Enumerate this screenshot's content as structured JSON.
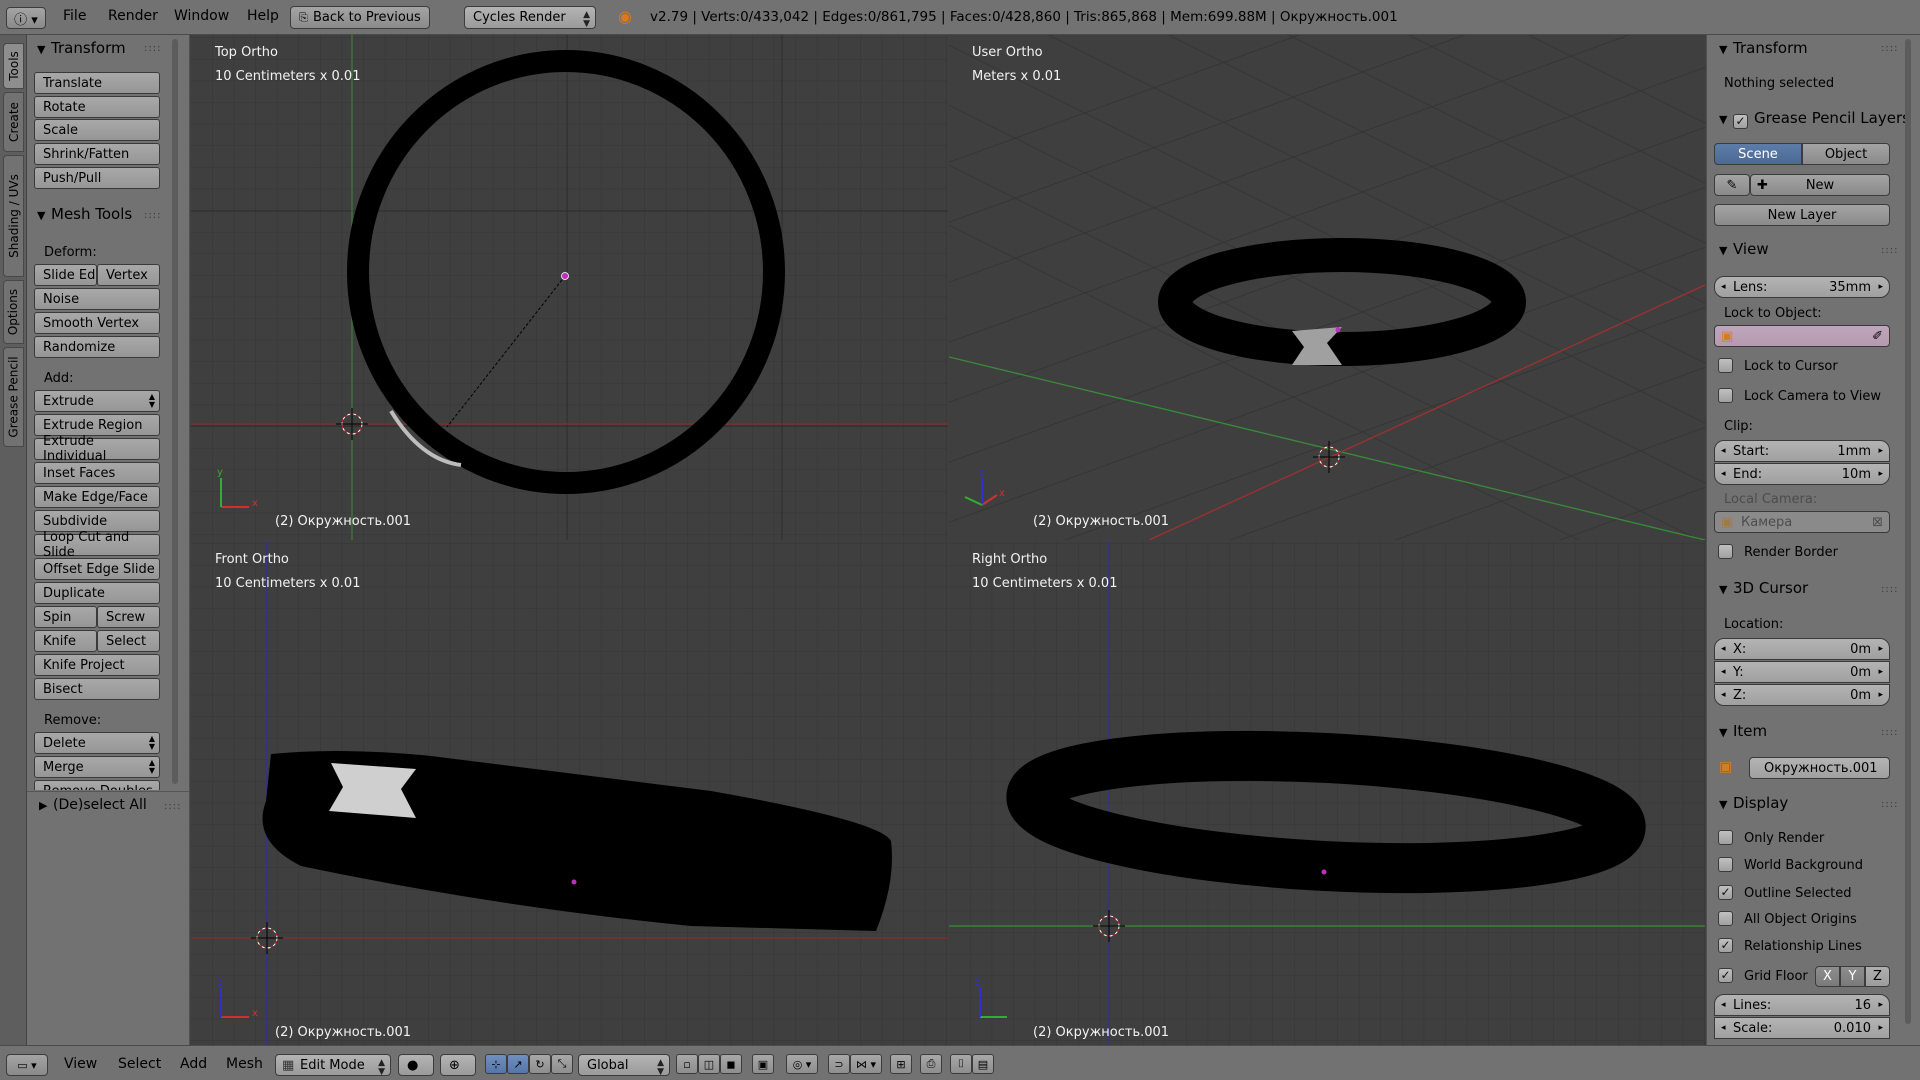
{
  "header": {
    "menus": [
      "File",
      "Render",
      "Window",
      "Help"
    ],
    "back_button": "Back to Previous",
    "render_engine": "Cycles Render",
    "stats": "v2.79 | Verts:0/433,042 | Edges:0/861,795 | Faces:0/428,860 | Tris:865,868 | Mem:699.88M | Окружность.001"
  },
  "left_tabs": [
    "Tools",
    "Create",
    "Shading / UVs",
    "Options",
    "Grease Pencil"
  ],
  "tools": {
    "transform_title": "Transform",
    "transform_buttons": [
      "Translate",
      "Rotate",
      "Scale",
      "Shrink/Fatten",
      "Push/Pull"
    ],
    "mesh_tools_title": "Mesh Tools",
    "deform_label": "Deform:",
    "slide_edge": "Slide Ed",
    "vertex": "Vertex",
    "noise": "Noise",
    "smooth_vertex": "Smooth Vertex",
    "randomize": "Randomize",
    "add_label": "Add:",
    "extrude": "Extrude",
    "extrude_region": "Extrude Region",
    "extrude_individual": "Extrude Individual",
    "inset_faces": "Inset Faces",
    "make_edge_face": "Make Edge/Face",
    "subdivide": "Subdivide",
    "loop_cut": "Loop Cut and Slide",
    "offset_edge": "Offset Edge Slide",
    "duplicate": "Duplicate",
    "spin": "Spin",
    "screw": "Screw",
    "knife": "Knife",
    "select": "Select",
    "knife_project": "Knife Project",
    "bisect": "Bisect",
    "remove_label": "Remove:",
    "delete": "Delete",
    "merge": "Merge",
    "remove_doubles": "Remove Doubles",
    "deselect_all": "(De)select All"
  },
  "viewports": {
    "top": {
      "title": "Top Ortho",
      "scale": "10 Centimeters x 0.01",
      "object": "(2) Окружность.001"
    },
    "user": {
      "title": "User Ortho",
      "scale": "Meters x 0.01",
      "object": "(2) Окружность.001"
    },
    "front": {
      "title": "Front Ortho",
      "scale": "10 Centimeters x 0.01",
      "object": "(2) Окружность.001"
    },
    "right": {
      "title": "Right Ortho",
      "scale": "10 Centimeters x 0.01",
      "object": "(2) Окружность.001"
    }
  },
  "properties": {
    "transform_title": "Transform",
    "nothing_selected": "Nothing selected",
    "gp_title": "Grease Pencil Layers",
    "scene_tab": "Scene",
    "object_tab": "Object",
    "new_button": "New",
    "new_layer": "New Layer",
    "view_title": "View",
    "lens_label": "Lens:",
    "lens_value": "35mm",
    "lock_to_object": "Lock to Object:",
    "lock_to_cursor": "Lock to Cursor",
    "lock_camera": "Lock Camera to View",
    "clip_label": "Clip:",
    "clip_start_label": "Start:",
    "clip_start": "1mm",
    "clip_end_label": "End:",
    "clip_end": "10m",
    "local_camera": "Local Camera:",
    "camera_value": "Камера",
    "render_border": "Render Border",
    "cursor_title": "3D Cursor",
    "location_label": "Location:",
    "x_label": "X:",
    "x_value": "0m",
    "y_label": "Y:",
    "y_value": "0m",
    "z_label": "Z:",
    "z_value": "0m",
    "item_title": "Item",
    "item_name": "Окружность.001",
    "display_title": "Display",
    "only_render": "Only Render",
    "world_background": "World Background",
    "outline_selected": "Outline Selected",
    "all_object_origins": "All Object Origins",
    "relationship_lines": "Relationship Lines",
    "grid_floor": "Grid Floor",
    "axis_x": "X",
    "axis_y": "Y",
    "axis_z": "Z",
    "lines_label": "Lines:",
    "lines_value": "16",
    "scale_label": "Scale:",
    "scale_value": "0.010"
  },
  "footer": {
    "view": "View",
    "select": "Select",
    "add": "Add",
    "mesh": "Mesh",
    "mode": "Edit Mode",
    "orientation": "Global"
  }
}
